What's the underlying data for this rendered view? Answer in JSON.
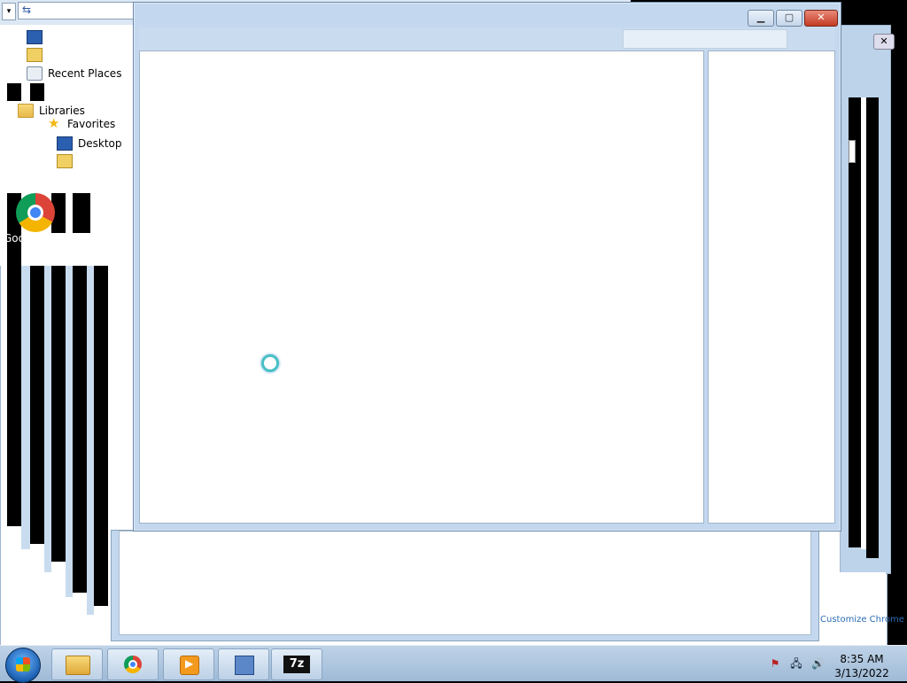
{
  "window": {
    "minimize_glyph": "▁",
    "maximize_glyph": "▢",
    "close_glyph": "✕"
  },
  "address": {
    "dropdown_glyph": "▾",
    "refresh_glyph": "⇆"
  },
  "nav": {
    "items": [
      {
        "label": "",
        "icon": "desktop-icon"
      },
      {
        "label": "",
        "icon": "downloads-icon"
      },
      {
        "label": "Recent Places",
        "icon": "recent-places-icon"
      },
      {
        "label": "Libraries",
        "icon": "libraries-icon"
      },
      {
        "label": "Favorites",
        "icon": "star-icon"
      },
      {
        "label": "Desktop",
        "icon": "desktop-icon"
      },
      {
        "label": "",
        "icon": "downloads-icon"
      }
    ]
  },
  "desktop": {
    "chrome_label": "Google Chr..."
  },
  "lower_window": {
    "customize_link": "Customize Chrome"
  },
  "taskbar": {
    "apps": [
      {
        "name": "Windows Explorer",
        "icon": "folder-icon"
      },
      {
        "name": "Google Chrome",
        "icon": "chrome-icon"
      },
      {
        "name": "Media Player",
        "icon": "media-icon"
      },
      {
        "name": "Network",
        "icon": "network-icon"
      },
      {
        "name": "7-Zip",
        "icon": "7zip-icon",
        "glyph": "7z"
      }
    ],
    "tray": {
      "flag_glyph": "⚑",
      "network_glyph": "🖧",
      "volume_glyph": "🔊",
      "time": "8:35 AM",
      "date": "3/13/2022"
    }
  }
}
